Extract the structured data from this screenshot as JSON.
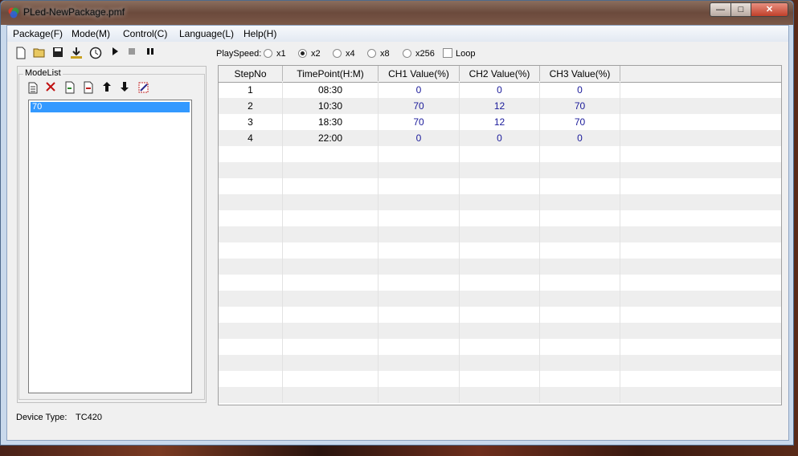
{
  "window": {
    "title": "PLed-NewPackage.pmf"
  },
  "menu": [
    "Package(F)",
    "Mode(M)",
    "Control(C)",
    "Language(L)",
    "Help(H)"
  ],
  "toolbar": {
    "icons": [
      "new-file-icon",
      "open-folder-icon",
      "save-icon",
      "download-icon",
      "clock-icon",
      "play-icon",
      "stop-icon",
      "pause-icon"
    ],
    "playspeed_label": "PlaySpeed:",
    "speeds": [
      {
        "label": "x1",
        "checked": false
      },
      {
        "label": "x2",
        "checked": true
      },
      {
        "label": "x4",
        "checked": false
      },
      {
        "label": "x8",
        "checked": false
      },
      {
        "label": "x256",
        "checked": false
      }
    ],
    "loop_label": "Loop",
    "loop_checked": false
  },
  "modelist": {
    "legend": "ModeList",
    "icons": [
      "new-mode-icon",
      "delete-icon",
      "import-icon",
      "export-icon",
      "move-up-icon",
      "move-down-icon",
      "edit-icon"
    ],
    "items": [
      "70"
    ]
  },
  "grid": {
    "headers": [
      "StepNo",
      "TimePoint(H:M)",
      "CH1 Value(%)",
      "CH2 Value(%)",
      "CH3 Value(%)"
    ],
    "rows": [
      [
        "1",
        "08:30",
        "0",
        "0",
        "0"
      ],
      [
        "2",
        "10:30",
        "70",
        "12",
        "70"
      ],
      [
        "3",
        "18:30",
        "70",
        "12",
        "70"
      ],
      [
        "4",
        "22:00",
        "0",
        "0",
        "0"
      ]
    ],
    "empty_rows": 16
  },
  "status": {
    "device_type_label": "Device Type:",
    "device_type_value": "TC420"
  }
}
